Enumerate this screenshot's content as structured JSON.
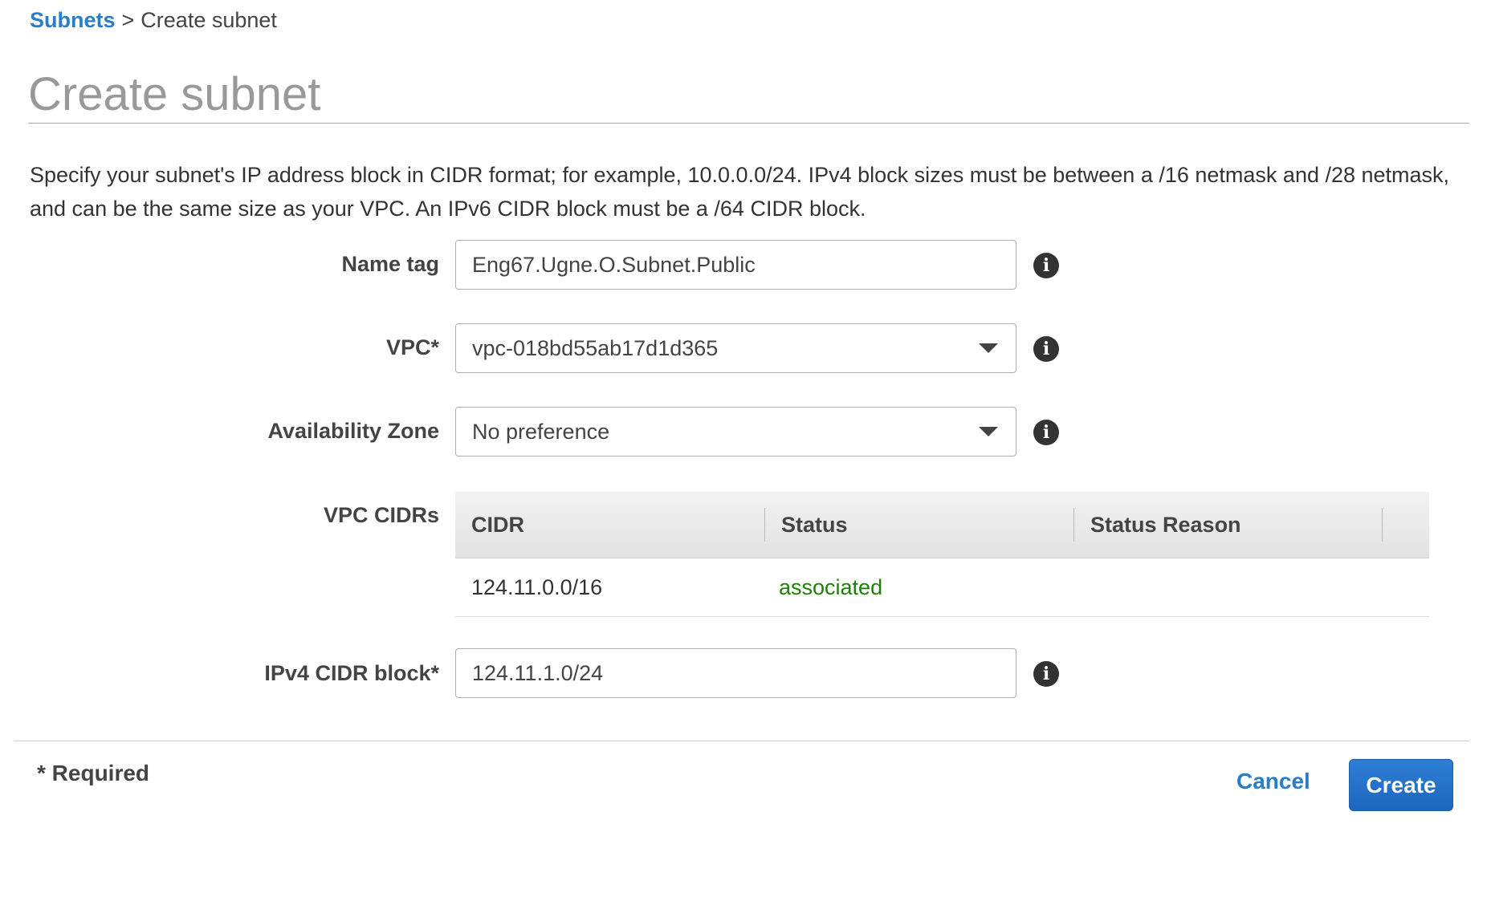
{
  "breadcrumb": {
    "parent_label": "Subnets",
    "separator": ">",
    "current_label": "Create subnet"
  },
  "page": {
    "title": "Create subnet",
    "description": "Specify your subnet's IP address block in CIDR format; for example, 10.0.0.0/24. IPv4 block sizes must be between a /16 netmask and /28 netmask, and can be the same size as your VPC. An IPv6 CIDR block must be a /64 CIDR block."
  },
  "form": {
    "name_tag": {
      "label": "Name tag",
      "value": "Eng67.Ugne.O.Subnet.Public"
    },
    "vpc": {
      "label": "VPC*",
      "value": "vpc-018bd55ab17d1d365"
    },
    "availability_zone": {
      "label": "Availability Zone",
      "value": "No preference"
    },
    "vpc_cidrs": {
      "label": "VPC CIDRs",
      "columns": [
        "CIDR",
        "Status",
        "Status Reason"
      ],
      "rows": [
        {
          "cidr": "124.11.0.0/16",
          "status": "associated",
          "status_reason": ""
        }
      ]
    },
    "ipv4_cidr_block": {
      "label": "IPv4 CIDR block*",
      "value": "124.11.1.0/24"
    }
  },
  "footer": {
    "required_note": "* Required",
    "cancel_label": "Cancel",
    "create_label": "Create"
  },
  "icons": {
    "info": "info-icon",
    "dropdown": "caret-down-icon"
  },
  "colors": {
    "link": "#2a7dc8",
    "status_associated": "#1d8102",
    "primary_button": "#1d66bd"
  }
}
